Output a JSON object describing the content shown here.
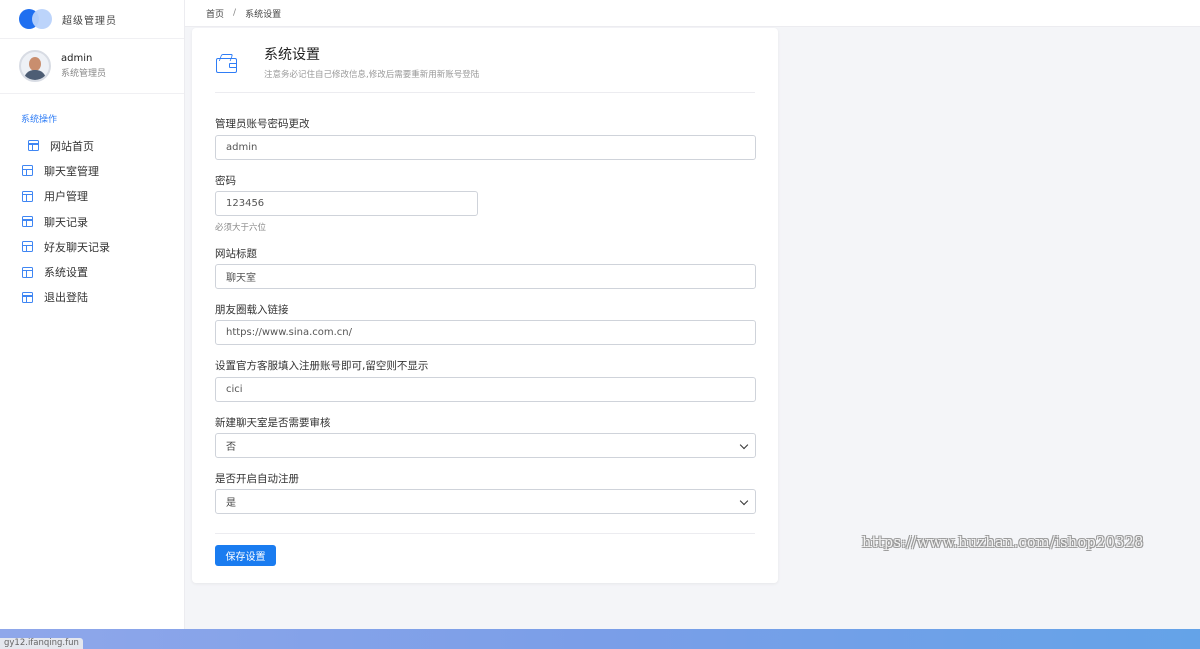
{
  "brand": {
    "name": "超级管理员"
  },
  "user": {
    "name": "admin",
    "role": "系统管理员"
  },
  "sidebar": {
    "section_title": "系统操作",
    "items": [
      {
        "label": "网站首页"
      },
      {
        "label": "聊天室管理"
      },
      {
        "label": "用户管理"
      },
      {
        "label": "聊天记录"
      },
      {
        "label": "好友聊天记录"
      },
      {
        "label": "系统设置"
      },
      {
        "label": "退出登陆"
      }
    ]
  },
  "breadcrumb": {
    "home": "首页",
    "separator": "/",
    "current": "系统设置"
  },
  "card": {
    "title": "系统设置",
    "subtitle": "注意务必记住自己修改信息,修改后需要重新用新账号登陆"
  },
  "form": {
    "account": {
      "label": "管理员账号密码更改",
      "value": "admin"
    },
    "password": {
      "label": "密码",
      "value": "123456",
      "help": "必须大于六位"
    },
    "site_title": {
      "label": "网站标题",
      "value": "聊天室"
    },
    "moments_link": {
      "label": "朋友圈载入链接",
      "value": "https://www.sina.com.cn/"
    },
    "support": {
      "label": "设置官方客服填入注册账号即可,留空则不显示",
      "value": "cici"
    },
    "room_review": {
      "label": "新建聊天室是否需要审核",
      "selected": "否"
    },
    "auto_register": {
      "label": "是否开启自动注册",
      "selected": "是"
    },
    "save_label": "保存设置"
  },
  "watermark": "https://www.huzhan.com/ishop20328",
  "status_bar": {
    "text": "gy12.ifanqing.fun"
  },
  "colors": {
    "accent": "#1a7cf0",
    "nav_icon": "#3f86f3"
  },
  "icons": {
    "brand": "brand-logo-icon",
    "nav": "layout-icon",
    "card": "wallet-icon",
    "select": "chevron-down-icon"
  }
}
